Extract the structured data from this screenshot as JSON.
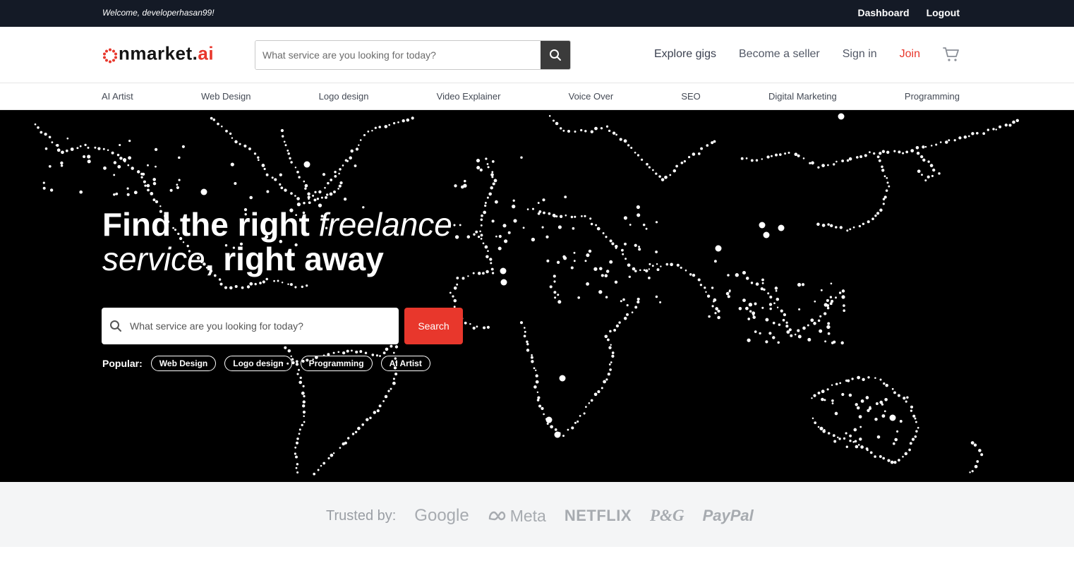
{
  "topbar": {
    "welcome": "Welcome, developerhasan99!",
    "dashboard": "Dashboard",
    "logout": "Logout"
  },
  "header": {
    "logo_main": "nmarket.",
    "logo_ai": "ai",
    "search_placeholder": "What service are you looking for today?",
    "nav": {
      "explore": "Explore gigs",
      "seller": "Become a seller",
      "signin": "Sign in",
      "join": "Join"
    }
  },
  "categories": [
    "AI Artist",
    "Web Design",
    "Logo design",
    "Video Explainer",
    "Voice Over",
    "SEO",
    "Digital Marketing",
    "Programming"
  ],
  "hero": {
    "title_1": "Find the right ",
    "title_em1": "freelance",
    "title_em2": "service",
    "title_2": ", right away",
    "search_placeholder": "What service are you looking for today?",
    "search_button": "Search",
    "popular_label": "Popular:",
    "popular": [
      "Web Design",
      "Logo design",
      "Programming",
      "AI Artist"
    ]
  },
  "trusted": {
    "label": "Trusted by:",
    "brands": {
      "google": "Google",
      "meta": "Meta",
      "netflix": "NETFLIX",
      "pg": "P&G",
      "paypal": "PayPal"
    }
  },
  "colors": {
    "accent": "#e8372c",
    "topbar": "#141a26",
    "hero_bg": "#000000"
  },
  "icons": [
    "search-icon",
    "cart-icon",
    "meta-infinity-icon"
  ]
}
